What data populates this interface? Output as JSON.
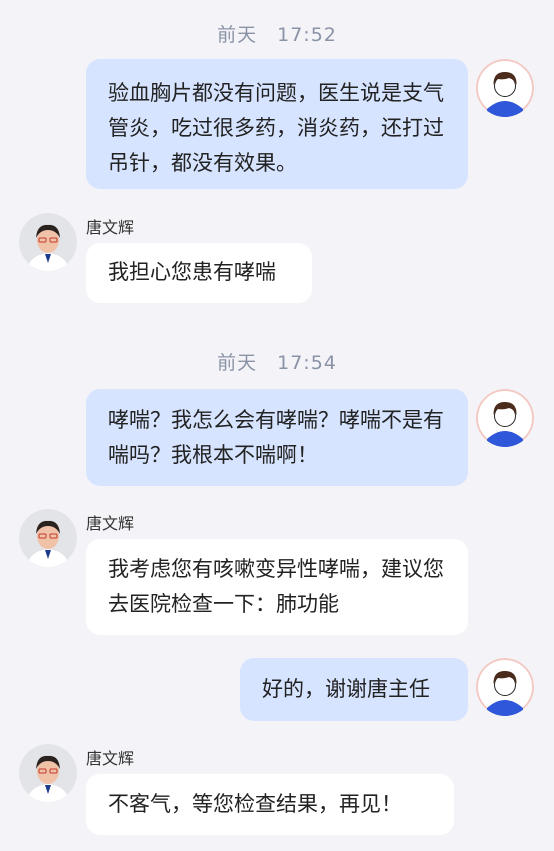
{
  "timestamps": [
    "前天　17:52",
    "前天　17:54"
  ],
  "doctor": {
    "name": "唐文辉"
  },
  "messages": [
    {
      "from": "user",
      "text": "验血胸片都没有问题，医生说是支气管炎，吃过很多药，消炎药，还打过吊针，都没有效果。"
    },
    {
      "from": "doctor",
      "text": "我担心您患有哮喘"
    },
    {
      "from": "user",
      "text": "哮喘？我怎么会有哮喘？哮喘不是有喘吗？我根本不喘啊！"
    },
    {
      "from": "doctor",
      "text": "我考虑您有咳嗽变异性哮喘，建议您去医院检查一下：肺功能"
    },
    {
      "from": "user",
      "text": "好的，谢谢唐主任"
    },
    {
      "from": "doctor",
      "text": "不客气，等您检查结果，再见！"
    }
  ],
  "colors": {
    "background": "#f4f4f8",
    "user_bubble": "#d7e4ff",
    "doctor_bubble": "#ffffff",
    "timestamp": "#8a93a6"
  },
  "icons": {
    "user_avatar": "user-avatar-icon",
    "doctor_avatar": "doctor-avatar-photo"
  }
}
